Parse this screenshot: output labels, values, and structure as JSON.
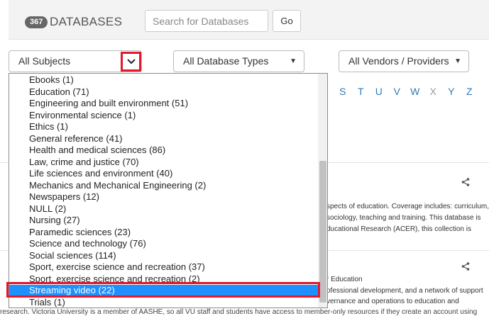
{
  "header": {
    "count": "367",
    "title": "DATABASES",
    "search_placeholder": "Search for Databases",
    "go_label": "Go"
  },
  "filters": {
    "subjects": "All Subjects",
    "types": "All Database Types",
    "vendors": "All Vendors / Providers"
  },
  "alphabet": [
    "S",
    "T",
    "U",
    "V",
    "W",
    "X",
    "Y",
    "Z"
  ],
  "alphabet_disabled": [
    "X"
  ],
  "subject_options": [
    "Ebooks (1)",
    "Education (71)",
    "Engineering and built environment (51)",
    "Environmental science (1)",
    "Ethics (1)",
    "General reference (41)",
    "Health and medical sciences (86)",
    "Law, crime and justice (70)",
    "Life sciences and environment (40)",
    "Mechanics and Mechanical Engineering (2)",
    "Newspapers (12)",
    "NULL (2)",
    "Nursing (27)",
    "Paramedic sciences (23)",
    "Science and technology (76)",
    "Social sciences (114)",
    "Sport, exercise science and recreation (37)",
    "Sport, exercise science and recreation (2)",
    "Streaming video (22)",
    "Trials (1)"
  ],
  "selected_index": 18,
  "background": {
    "desc1_line1": "spects of education. Coverage includes: curriculum,",
    "desc1_line2": "sociology, teaching and training. This database is",
    "desc1_line3": "ducational Research (ACER), this collection is",
    "desc2_heading": "r Education",
    "desc2_line1": "ofessional development, and a network of support",
    "desc2_line2": "vernance and operations to education and",
    "bottom_line": "research. Victoria University is a member of AASHE, so all VU staff and students have access to member-only resources if they create an account using"
  },
  "colors": {
    "link": "#337ab7",
    "highlight": "#e0192b",
    "selected_bg": "#1e90ff",
    "badge_bg": "#666666"
  }
}
